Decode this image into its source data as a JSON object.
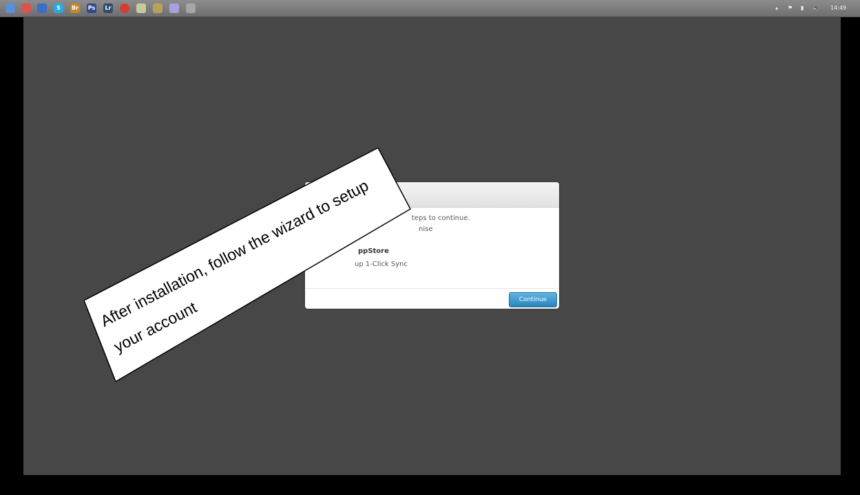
{
  "taskbar": {
    "icons": [
      {
        "name": "firefox-icon",
        "color": "#5a8fd6",
        "glyph": ""
      },
      {
        "name": "app-icon-2",
        "color": "#d9534f",
        "glyph": ""
      },
      {
        "name": "app-icon-3",
        "color": "#3b6ec8",
        "glyph": ""
      },
      {
        "name": "skype-icon",
        "color": "#2aa8e0",
        "glyph": "S"
      },
      {
        "name": "bridge-icon",
        "color": "#c6862a",
        "glyph": "Br"
      },
      {
        "name": "photoshop-icon",
        "color": "#2e4c8c",
        "glyph": "Ps"
      },
      {
        "name": "lightroom-icon",
        "color": "#334b6e",
        "glyph": "Lr"
      },
      {
        "name": "app-icon-8",
        "color": "#d63c2f",
        "glyph": ""
      },
      {
        "name": "app-icon-9",
        "color": "#c9c9a0",
        "glyph": ""
      },
      {
        "name": "folder-icon",
        "color": "#b8a15e",
        "glyph": ""
      },
      {
        "name": "app-icon-11",
        "color": "#a8a0d8",
        "glyph": ""
      },
      {
        "name": "app-icon-12",
        "color": "#a6a6a6",
        "glyph": ""
      }
    ],
    "clock": "14:49"
  },
  "dialog": {
    "line1": "teps to continue.",
    "line2": "nise",
    "line3": "ppStore",
    "line4": "up 1-Click Sync",
    "continue_label": "Continue"
  },
  "callout": {
    "text": "After installation, follow the wizard to setup your account"
  }
}
